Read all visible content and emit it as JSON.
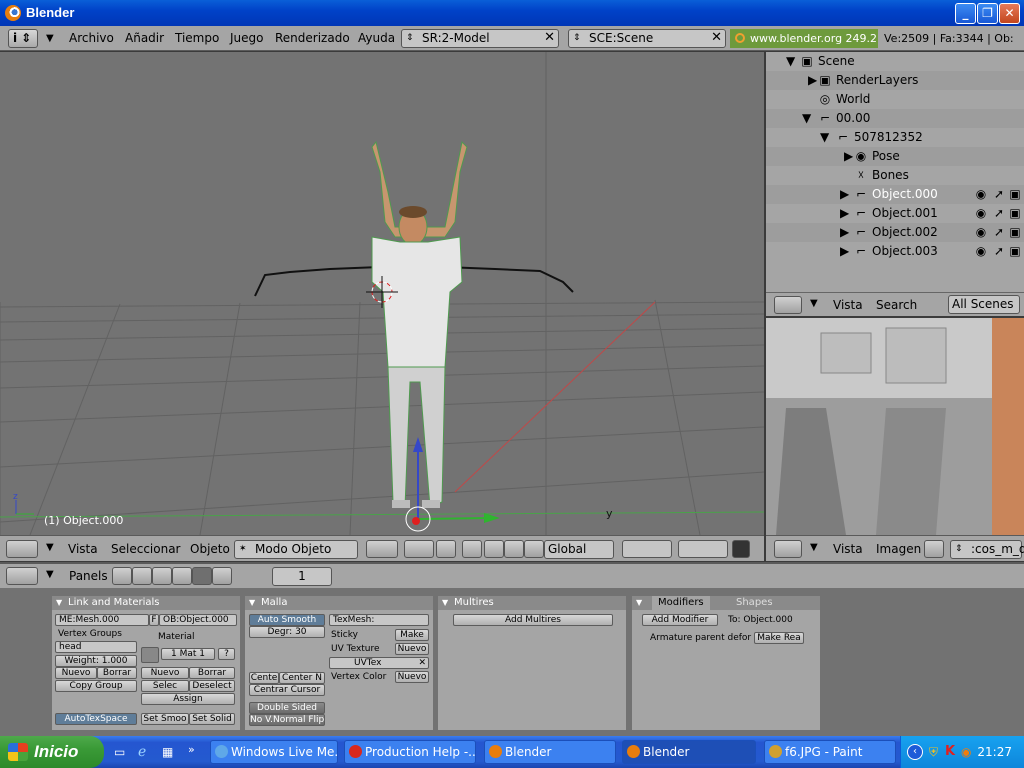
{
  "window": {
    "title": "Blender"
  },
  "menu": {
    "items": [
      "Archivo",
      "Añadir",
      "Tiempo",
      "Juego",
      "Renderizado",
      "Ayuda"
    ],
    "screen_field": "SR:2-Model",
    "scene_field": "SCE:Scene",
    "site": "www.blender.org 249.2",
    "stats": "Ve:2509 | Fa:3344 | Ob:"
  },
  "viewport": {
    "object_label": "(1) Object.000",
    "axis_y": "y",
    "axis_z": "z"
  },
  "viewport_header": {
    "menus": [
      "Vista",
      "Seleccionar",
      "Objeto"
    ],
    "mode": "Modo Objeto",
    "orientation": "Global"
  },
  "outliner": {
    "rows": [
      {
        "label": "Scene",
        "icon": "scene-icon"
      },
      {
        "label": "RenderLayers",
        "icon": "renderlayers-icon"
      },
      {
        "label": "World",
        "icon": "world-icon"
      },
      {
        "label": "00.00",
        "icon": "armature-icon"
      },
      {
        "label": "507812352",
        "icon": "armature-icon"
      },
      {
        "label": "Pose",
        "icon": "pose-icon"
      },
      {
        "label": "Bones",
        "icon": "bones-icon"
      },
      {
        "label": "Object.000",
        "icon": "object-icon",
        "selected": true
      },
      {
        "label": "Object.001",
        "icon": "object-icon"
      },
      {
        "label": "Object.002",
        "icon": "object-icon"
      },
      {
        "label": "Object.003",
        "icon": "object-icon"
      }
    ],
    "header": {
      "view": "Vista",
      "search": "Search",
      "scope": "All Scenes"
    }
  },
  "image_header": {
    "view": "Vista",
    "image": "Imagen",
    "image_field": ":cos_m_d"
  },
  "buttons_header": {
    "panels": "Panels",
    "frame": "1"
  },
  "link_materials": {
    "title": "Link and Materials",
    "mesh": "ME:Mesh.000",
    "f": "F",
    "object": "OB:Object.000",
    "vertex_groups": "Vertex Groups",
    "material": "Material",
    "group_name": "head",
    "weight": "Weight: 1.000",
    "mat_index": "1 Mat 1",
    "question": "?",
    "nuevo": "Nuevo",
    "borrar": "Borrar",
    "copy_group": "Copy Group",
    "selec": "Selec",
    "deselect": "Deselect",
    "assign": "Assign",
    "autotexspace": "AutoTexSpace",
    "set_smooth": "Set Smoo",
    "set_solid": "Set Solid"
  },
  "malla": {
    "title": "Malla",
    "auto_smooth": "Auto Smooth",
    "degr": "Degr: 30",
    "texmesh": "TexMesh:",
    "sticky": "Sticky",
    "make": "Make",
    "uv_texture": "UV Texture",
    "nuevo": "Nuevo",
    "uvtex": "UVTex",
    "vertex_color": "Vertex Color",
    "center": "Cente",
    "center_new": "Center N",
    "center_cursor": "Centrar Cursor",
    "double_sided": "Double Sided",
    "normal_flip": "No V.Normal Flip"
  },
  "multires": {
    "title": "Multires",
    "add": "Add Multires"
  },
  "modifiers": {
    "tab_modifiers": "Modifiers",
    "tab_shapes": "Shapes",
    "add_modifier": "Add Modifier",
    "to": "To: Object.000",
    "armature_note": "Armature parent defor",
    "make_real": "Make Rea"
  },
  "taskbar": {
    "start": "Inicio",
    "tasks": [
      {
        "label": "Windows Live Me...",
        "color": "#5fa8e8"
      },
      {
        "label": "Production Help -...",
        "color": "#d9281e"
      },
      {
        "label": "Blender",
        "color": "#e87d0d"
      },
      {
        "label": "Blender",
        "color": "#e87d0d",
        "active": true
      },
      {
        "label": "f6.JPG - Paint",
        "color": "#d0a030"
      }
    ],
    "clock": "21:27"
  }
}
